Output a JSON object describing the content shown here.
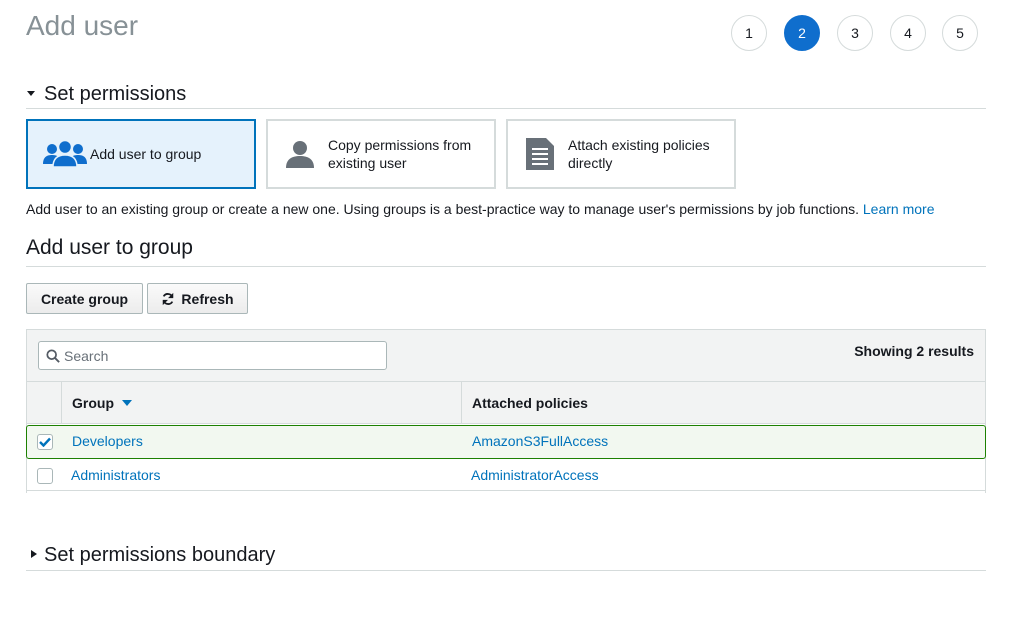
{
  "page": {
    "title": "Add user"
  },
  "steps": [
    "1",
    "2",
    "3",
    "4",
    "5"
  ],
  "active_step": "2",
  "permissions_section": {
    "title": "Set permissions"
  },
  "options": [
    {
      "label": "Add user to group",
      "icon": "group-icon",
      "selected": true
    },
    {
      "label_line1": "Copy permissions from",
      "label_line2": "existing user",
      "icon": "user-icon",
      "selected": false
    },
    {
      "label_line1": "Attach existing policies",
      "label_line2": "directly",
      "icon": "document-icon",
      "selected": false
    }
  ],
  "description": {
    "text": "Add user to an existing group or create a new one. Using groups is a best-practice way to manage user's permissions by job functions. ",
    "link": "Learn more"
  },
  "group_section": {
    "title": "Add user to group"
  },
  "toolbar": {
    "create_group": "Create group",
    "refresh": "Refresh"
  },
  "search": {
    "placeholder": "Search",
    "value": ""
  },
  "results_text": "Showing 2 results",
  "table": {
    "columns": {
      "group": "Group",
      "policies": "Attached policies"
    },
    "rows": [
      {
        "group": "Developers",
        "policy": "AmazonS3FullAccess",
        "checked": true
      },
      {
        "group": "Administrators",
        "policy": "AdministratorAccess",
        "checked": false
      }
    ]
  },
  "boundary_section": {
    "title": "Set permissions boundary"
  },
  "colors": {
    "accent": "#0073bb",
    "step_active": "#0f6ecd",
    "selected_row_border": "#1d8102"
  }
}
